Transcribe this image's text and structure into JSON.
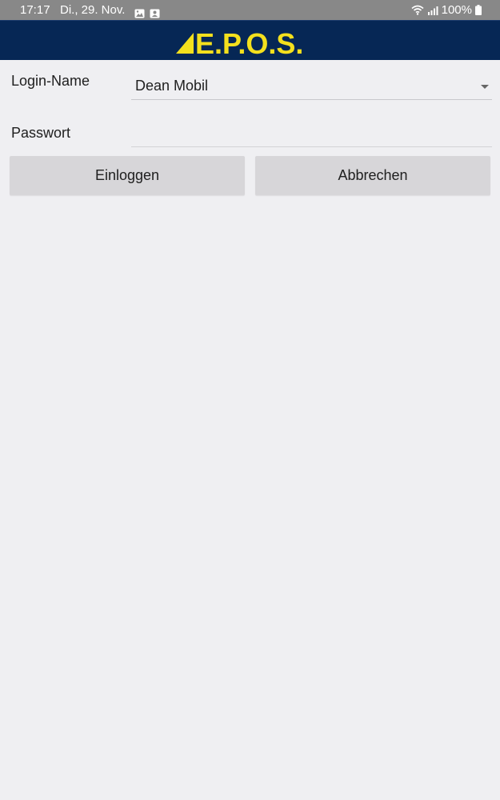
{
  "status_bar": {
    "time": "17:17",
    "date": "Di., 29. Nov.",
    "notification_icons": [
      "image-icon",
      "contact-card-icon"
    ],
    "battery": "100%",
    "colors": {
      "bar": "#888888",
      "text": "#ffffff"
    }
  },
  "header": {
    "logo_text": "E.P.O.S.",
    "colors": {
      "background": "#062755",
      "logo": "#f4e01d"
    }
  },
  "form": {
    "login_label": "Login-Name",
    "login_value": "Dean Mobil",
    "password_label": "Passwort",
    "password_value": ""
  },
  "buttons": {
    "login": "Einloggen",
    "cancel": "Abbrechen"
  },
  "colors": {
    "page_background": "#efeff2",
    "button_background": "#d7d6d9"
  }
}
